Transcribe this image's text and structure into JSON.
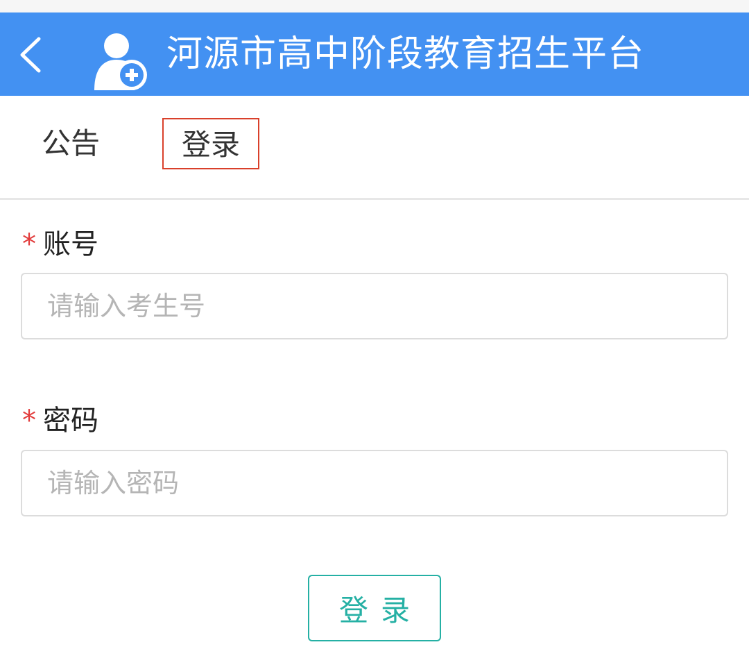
{
  "header": {
    "title": "河源市高中阶段教育招生平台",
    "back_icon": "chevron-left-icon",
    "logo_icon": "user-add-icon",
    "bg_color": "#4391f2"
  },
  "tabs": [
    {
      "label": "公告"
    },
    {
      "label": "登录",
      "selected": true
    }
  ],
  "form": {
    "account": {
      "required_mark": "*",
      "label": "账号",
      "placeholder": "请输入考生号",
      "value": ""
    },
    "password": {
      "required_mark": "*",
      "label": "密码",
      "placeholder": "请输入密码",
      "value": ""
    },
    "submit_label": "登录"
  },
  "colors": {
    "accent": "#25b0a4",
    "required": "#e23b3b",
    "tab_highlight": "#d9402b"
  }
}
